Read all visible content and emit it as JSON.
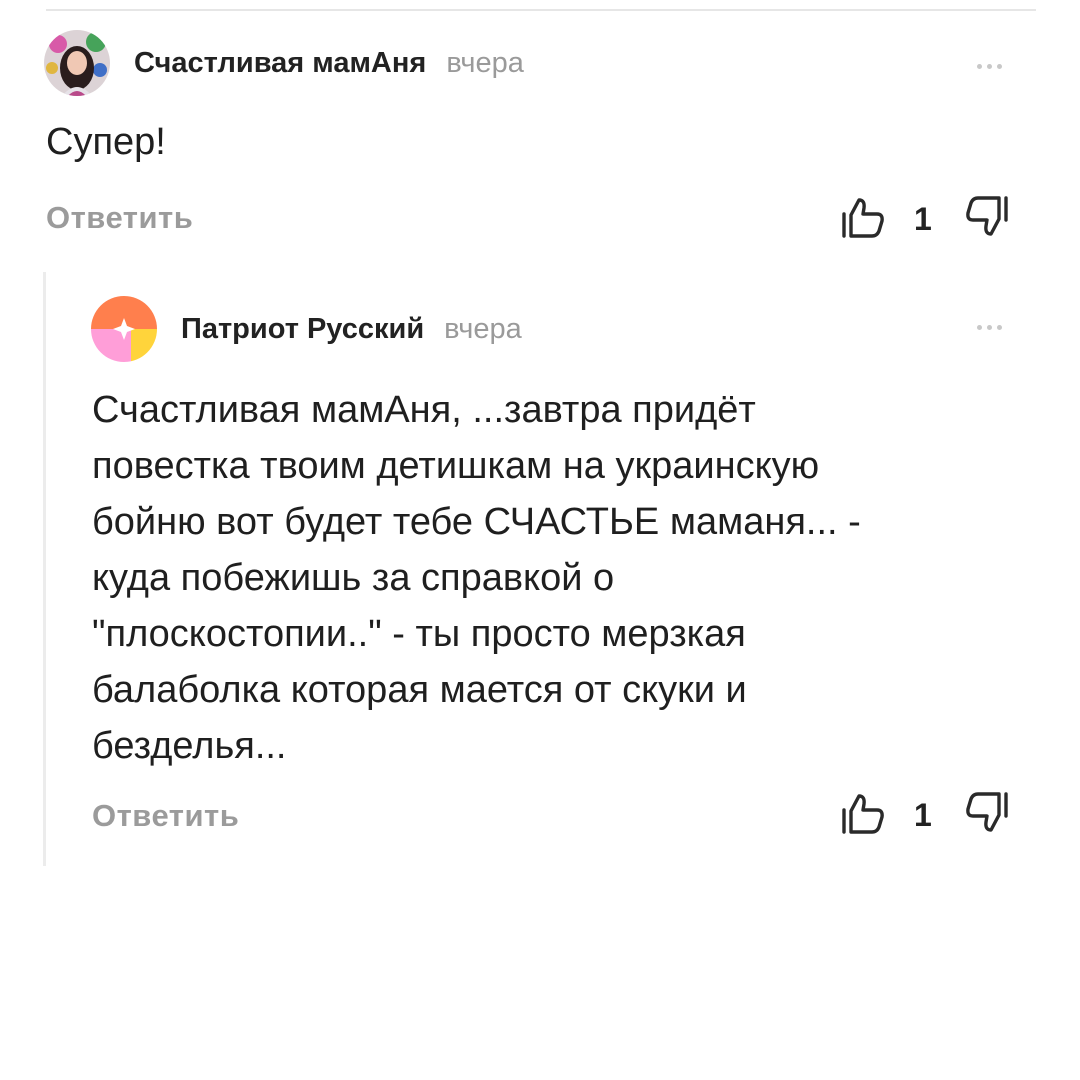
{
  "comments": [
    {
      "author": "Счастливая мамАня",
      "time": "вчера",
      "text": "Супер!",
      "reply_label": "Ответить",
      "likes": "1",
      "avatar": "photo"
    },
    {
      "author": "Патриот Русский",
      "time": "вчера",
      "text": "Счастливая мамАня, ...завтра придёт\nповестка твоим детишкам на украинскую\nбойню вот будет тебе СЧАСТЬЕ маманя... -\nкуда побежишь за справкой о\n\"плоскостопии..\" - ты просто мерзкая\nбалаболка которая мается от скуки и\nбезделья...",
      "reply_label": "Ответить",
      "likes": "1",
      "avatar": "default-colorful"
    }
  ],
  "icons": {
    "more": "more-dots-icon",
    "like": "thumb-up-icon",
    "dislike": "thumb-down-icon"
  },
  "colors": {
    "background": "#ffffff",
    "text": "#1f1f1f",
    "muted": "#9a9a9a",
    "thread_line": "#ececec"
  }
}
